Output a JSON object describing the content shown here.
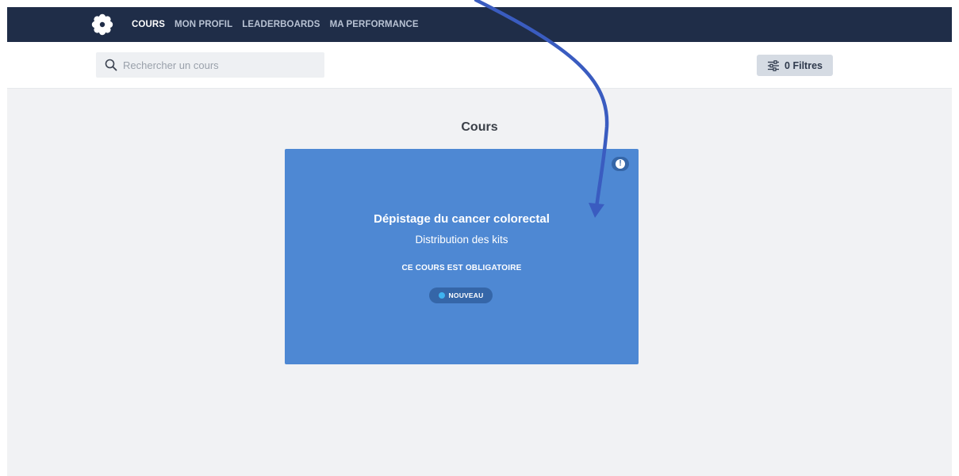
{
  "nav": {
    "links": [
      "COURS",
      "MON PROFIL",
      "LEADERBOARDS",
      "MA PERFORMANCE"
    ],
    "active_index": 0,
    "logo_icon": "flower-logo-icon"
  },
  "search": {
    "placeholder": "Rechercher un cours",
    "value": "",
    "icon": "search-icon"
  },
  "filters": {
    "label": "0 Filtres",
    "icon": "sliders-icon"
  },
  "section": {
    "title": "Cours"
  },
  "course": {
    "title": "Dépistage du cancer colorectal",
    "subtitle": "Distribution des kits",
    "mandatory_text": "CE COURS EST OBLIGATOIRE",
    "badge_label": "NOUVEAU",
    "alert_icon": "exclamation-icon",
    "card_color": "#4e88d3"
  },
  "colors": {
    "navbar": "#1f2d48",
    "background": "#f1f2f4",
    "badge_dot": "#3fb3f0",
    "annotation_arrow": "#3a5cc0"
  }
}
